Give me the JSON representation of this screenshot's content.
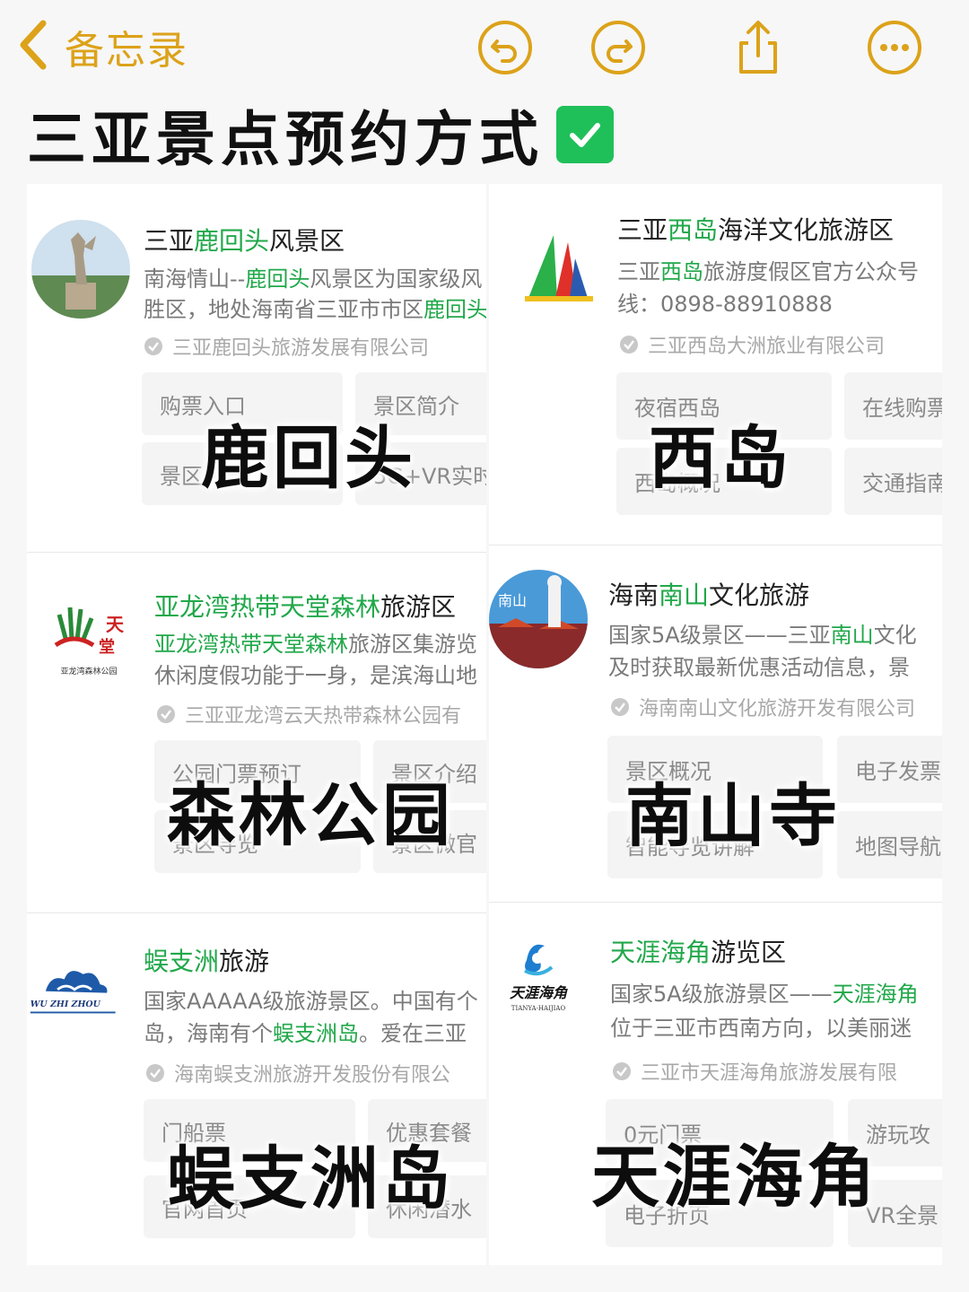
{
  "nav": {
    "back_label": "备忘录"
  },
  "title": "三亚景点预约方式",
  "cards": [
    {
      "title_parts": [
        "三亚",
        "鹿回头",
        "风景区"
      ],
      "desc1_parts": [
        "南海情山--",
        "鹿回头",
        "风景区为国家级风"
      ],
      "desc2_parts": [
        "胜区，地处海南省三亚市市区",
        "鹿回头",
        ""
      ],
      "verified": "三亚鹿回头旅游发展有限公司",
      "buttons": [
        "购票入口",
        "景区简介",
        "景区人气",
        "5G+VR实时"
      ],
      "overlay": "鹿回头"
    },
    {
      "title_parts": [
        "三亚",
        "西岛",
        "海洋文化旅游区"
      ],
      "desc1_parts": [
        "三亚",
        "西岛",
        "旅游度假区官方公众号"
      ],
      "desc2_parts": [
        "线：0898-88910888",
        "",
        ""
      ],
      "verified": "三亚西岛大洲旅业有限公司",
      "buttons": [
        "夜宿西岛",
        "在线购票",
        "西岛概况",
        "交通指南"
      ],
      "overlay": "西岛"
    },
    {
      "title_parts": [
        "",
        "亚龙湾热带天堂森林",
        "旅游区"
      ],
      "desc1_parts": [
        "",
        "亚龙湾热带天堂森林",
        "旅游区集游览"
      ],
      "desc2_parts": [
        "休闲度假功能于一身，是滨海山地",
        "",
        ""
      ],
      "verified": "三亚亚龙湾云天热带森林公园有",
      "buttons": [
        "公园门票预订",
        "景区介绍",
        "景区导览",
        "景区微官"
      ],
      "overlay": "森林公园"
    },
    {
      "title_parts": [
        "海南",
        "南山",
        "文化旅游"
      ],
      "desc1_parts": [
        "国家5A级景区——三亚",
        "南山",
        "文化"
      ],
      "desc2_parts": [
        "及时获取最新优惠活动信息，景",
        "",
        ""
      ],
      "verified": "海南南山文化旅游开发有限公司",
      "buttons": [
        "景区概况",
        "电子发票",
        "智能导览讲解",
        "地图导航"
      ],
      "overlay": "南山寺"
    },
    {
      "title_parts": [
        "",
        "蜈支洲",
        "旅游"
      ],
      "desc1_parts": [
        "国家AAAAA级旅游景区。中国有个",
        "",
        ""
      ],
      "desc2_parts": [
        "岛，海南有个",
        "蜈支洲岛",
        "。爱在三亚"
      ],
      "verified": "海南蜈支洲旅游开发股份有限公",
      "buttons": [
        "门船票",
        "优惠套餐",
        "官网首页",
        "休闲潜水"
      ],
      "overlay": "蜈支洲岛"
    },
    {
      "title_parts": [
        "",
        "天涯海角",
        "游览区"
      ],
      "desc1_parts": [
        "国家5A级旅游景区——",
        "天涯海角",
        ""
      ],
      "desc2_parts": [
        "位于三亚市西南方向，以美丽迷",
        "",
        ""
      ],
      "verified": "三亚市天涯海角旅游发展有限",
      "buttons": [
        "0元门票",
        "游玩攻",
        "电子折页",
        "VR全景"
      ],
      "overlay": "天涯海角"
    }
  ],
  "logo_text": {
    "forest": "亚龙湾森林公园",
    "nanshan": "南山",
    "wuzhizhou": "WU ZHI ZHOU",
    "tianya": "天涯海角",
    "tianya_en": "TIANYA-HAIJIAO"
  },
  "colors": {
    "accent": "#dca21a",
    "highlight": "#21a84a",
    "check_bg": "#1fc05a"
  }
}
